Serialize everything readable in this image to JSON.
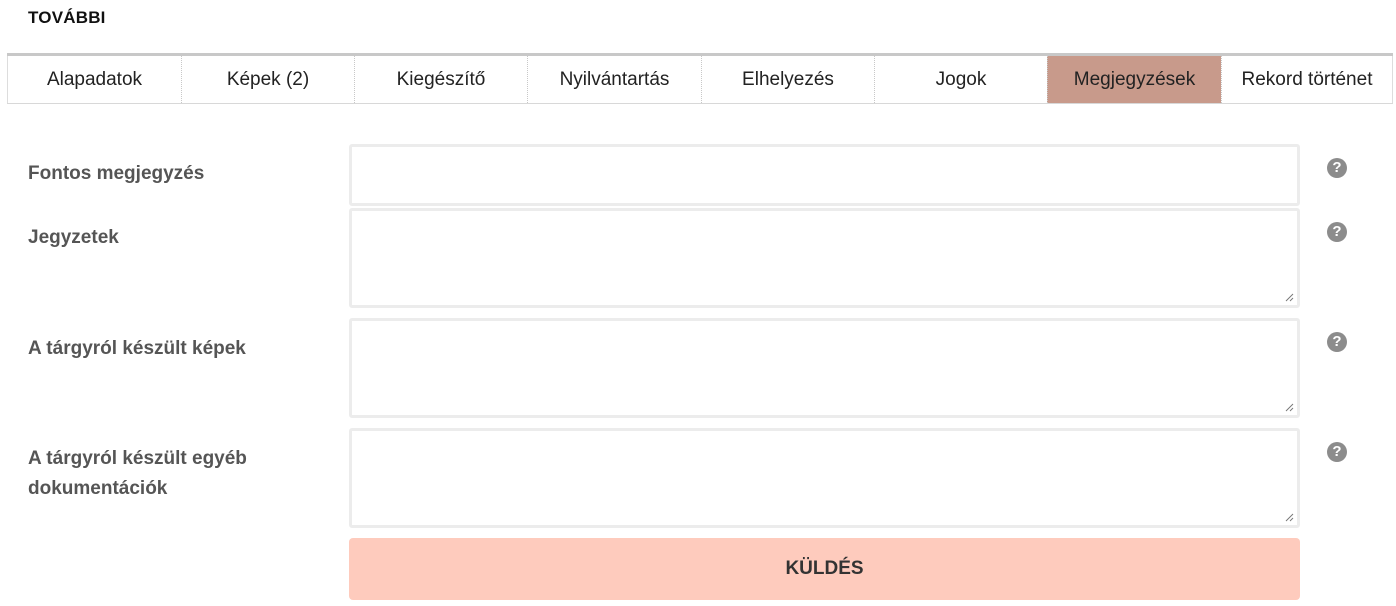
{
  "section": {
    "title": "TOVÁBBI"
  },
  "tabs": [
    {
      "label": "Alapadatok",
      "active": false
    },
    {
      "label": "Képek (2)",
      "active": false
    },
    {
      "label": "Kiegészítő",
      "active": false
    },
    {
      "label": "Nyilvántartás",
      "active": false
    },
    {
      "label": "Elhelyezés",
      "active": false
    },
    {
      "label": "Jogok",
      "active": false
    },
    {
      "label": "Megjegyzések",
      "active": true
    },
    {
      "label": "Rekord történet",
      "active": false
    }
  ],
  "form": {
    "fields": [
      {
        "label": "Fontos megjegyzés",
        "value": "",
        "type": "input"
      },
      {
        "label": "Jegyzetek",
        "value": "",
        "type": "textarea"
      },
      {
        "label": "A tárgyról készült képek",
        "value": "",
        "type": "textarea"
      },
      {
        "label": "A tárgyról készült egyéb dokumentációk",
        "value": "",
        "type": "textarea"
      }
    ],
    "help_icon": "question-circle-icon",
    "help_glyph": "?",
    "submit_label": "KÜLDÉS"
  },
  "colors": {
    "active_tab": "#c89a8b",
    "submit_bg": "#fecbbd",
    "help_icon": "#8c8c8c"
  }
}
